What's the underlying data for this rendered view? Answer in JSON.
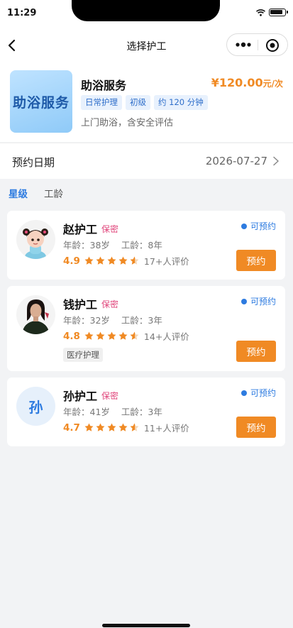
{
  "status_bar": {
    "time": "11:29"
  },
  "nav": {
    "title": "选择护工"
  },
  "service": {
    "thumb_text": "助浴服务",
    "name": "助浴服务",
    "price": "¥120.00",
    "price_unit": "元/次",
    "tags": [
      "日常护理",
      "初级",
      "约 120 分钟"
    ],
    "description": "上门助浴，含安全评估"
  },
  "booking": {
    "date_label": "预约日期",
    "date_value": "2026-07-27"
  },
  "sort": {
    "tabs": [
      "星级",
      "工龄"
    ],
    "active": "星级"
  },
  "caregivers": [
    {
      "name": "赵护工",
      "badge": "保密",
      "age_text": "年龄：38岁",
      "exp_text": "工龄：8年",
      "score": "4.9",
      "rating": 4.9,
      "reviews": "17+人评价",
      "status": "可预约",
      "book_label": "预约",
      "avatar": "cartoon-girl",
      "specialty": ""
    },
    {
      "name": "钱护工",
      "badge": "保密",
      "age_text": "年龄：32岁",
      "exp_text": "工龄：3年",
      "score": "4.8",
      "rating": 4.8,
      "reviews": "14+人评价",
      "status": "可预约",
      "book_label": "预约",
      "avatar": "woman-photo",
      "specialty": "医疗护理"
    },
    {
      "name": "孙护工",
      "badge": "保密",
      "age_text": "年龄：41岁",
      "exp_text": "工龄：3年",
      "score": "4.7",
      "rating": 4.7,
      "reviews": "11+人评价",
      "status": "可预约",
      "book_label": "预约",
      "avatar": "initial",
      "avatar_text": "孙",
      "specialty": ""
    }
  ],
  "colors": {
    "accent": "#f08a24",
    "primary": "#2d7be0",
    "badge": "#e0457b",
    "background": "#f2f3f5"
  }
}
